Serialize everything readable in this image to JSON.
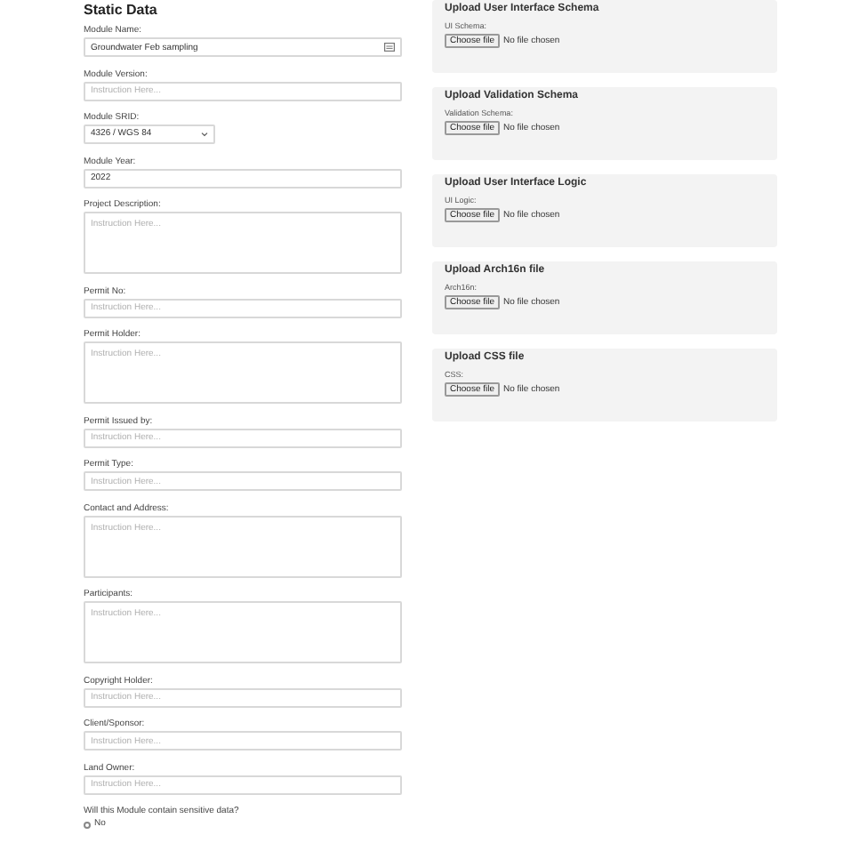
{
  "static_data": {
    "title": "Static Data",
    "fields": [
      {
        "kind": "input",
        "label": "Module Name:",
        "value": "Groundwater Feb sampling",
        "icon": true
      },
      {
        "kind": "input",
        "label": "Module Version:",
        "placeholder": "Instruction Here..."
      },
      {
        "kind": "select",
        "label": "Module SRID:",
        "value": "4326 / WGS 84"
      },
      {
        "kind": "input",
        "label": "Module Year:",
        "value": "2022"
      },
      {
        "kind": "textarea",
        "label": "Project Description:",
        "placeholder": "Instruction Here..."
      },
      {
        "kind": "input",
        "label": "Permit No:",
        "placeholder": "Instruction Here..."
      },
      {
        "kind": "textarea",
        "label": "Permit Holder:",
        "placeholder": "Instruction Here..."
      },
      {
        "kind": "input",
        "label": "Permit Issued by:",
        "placeholder": "Instruction Here..."
      },
      {
        "kind": "input",
        "label": "Permit Type:",
        "placeholder": "Instruction Here..."
      },
      {
        "kind": "textarea",
        "label": "Contact and Address:",
        "placeholder": "Instruction Here..."
      },
      {
        "kind": "textarea",
        "label": "Participants:",
        "placeholder": "Instruction Here..."
      },
      {
        "kind": "input",
        "label": "Copyright Holder:",
        "placeholder": "Instruction Here..."
      },
      {
        "kind": "input",
        "label": "Client/Sponsor:",
        "placeholder": "Instruction Here..."
      },
      {
        "kind": "input",
        "label": "Land Owner:",
        "placeholder": "Instruction Here..."
      }
    ],
    "question": {
      "label": "Will this Module contain sensitive data?",
      "options": [
        {
          "label": "No",
          "selected": false
        }
      ]
    }
  },
  "uploads": [
    {
      "title": "Upload User Interface Schema",
      "label": "UI Schema:",
      "button": "Choose file",
      "status": "No file chosen"
    },
    {
      "title": "Upload Validation Schema",
      "label": "Validation Schema:",
      "button": "Choose file",
      "status": "No file chosen"
    },
    {
      "title": "Upload User Interface Logic",
      "label": "UI Logic:",
      "button": "Choose file",
      "status": "No file chosen"
    },
    {
      "title": "Upload Arch16n file",
      "label": "Arch16n:",
      "button": "Choose file",
      "status": "No file chosen"
    },
    {
      "title": "Upload CSS file",
      "label": "CSS:",
      "button": "Choose file",
      "status": "No file chosen"
    }
  ]
}
